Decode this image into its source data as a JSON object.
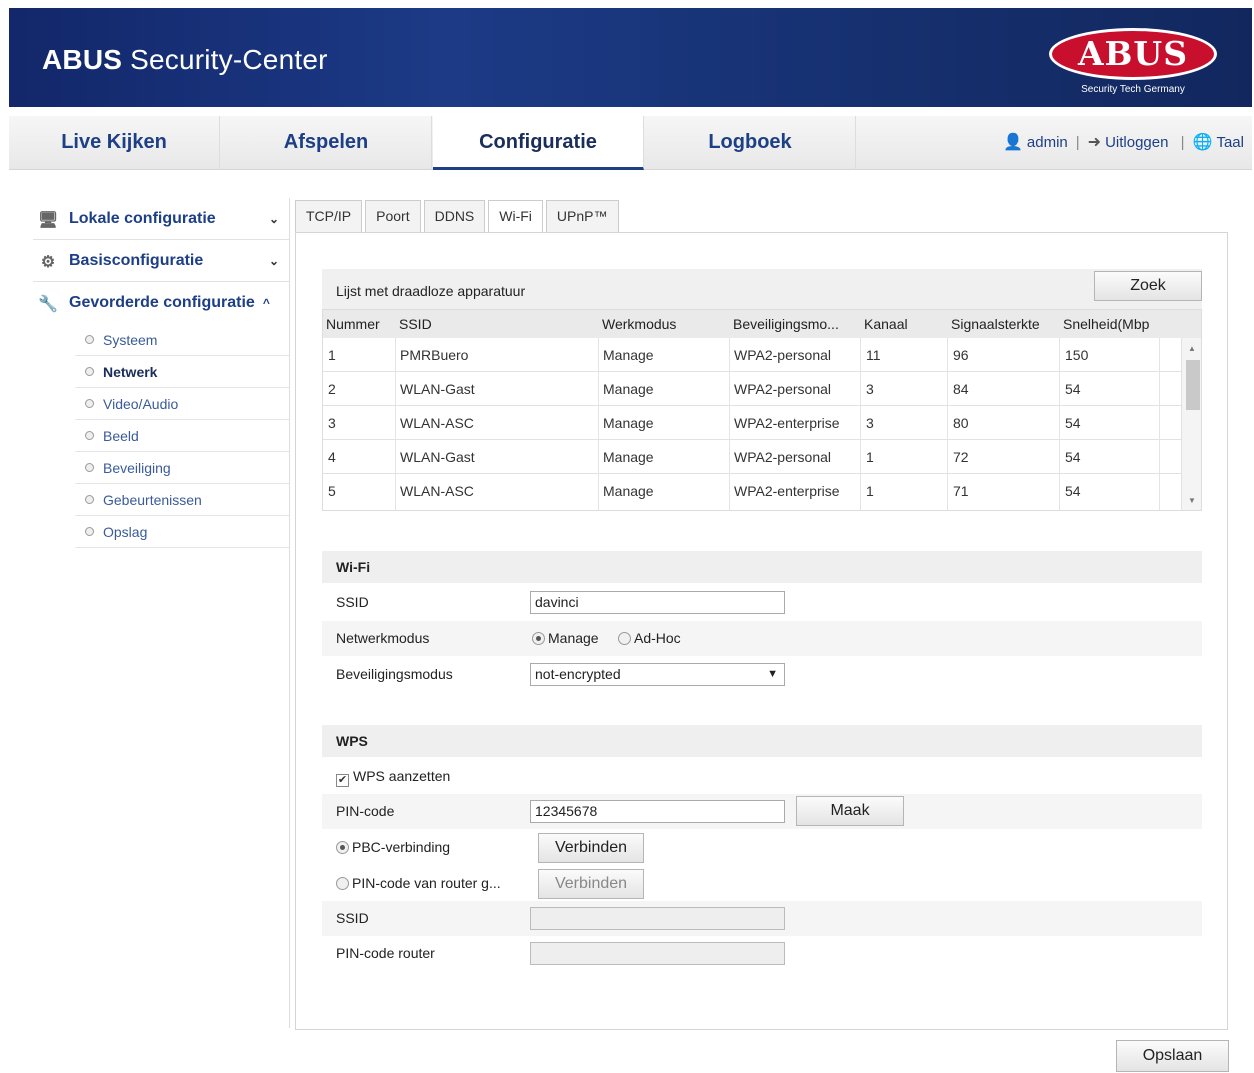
{
  "app": {
    "title_bold": "ABUS",
    "title_rest": " Security-Center",
    "logo_text": "ABUS",
    "logo_sub": "Security Tech Germany"
  },
  "nav": {
    "tabs": [
      "Live Kijken",
      "Afspelen",
      "Configuratie",
      "Logboek"
    ],
    "active": "Configuratie",
    "user": "admin",
    "logout": "Uitloggen",
    "language": "Taal"
  },
  "sidebar": {
    "groups": [
      {
        "label": "Lokale configuratie",
        "icon": "monitor-icon",
        "chevron": "⌄"
      },
      {
        "label": "Basisconfiguratie",
        "icon": "gear-icon",
        "chevron": "⌄"
      },
      {
        "label": "Gevorderde configuratie",
        "icon": "wrench-icon",
        "chevron": "^"
      }
    ],
    "items": [
      "Systeem",
      "Netwerk",
      "Video/Audio",
      "Beeld",
      "Beveiliging",
      "Gebeurtenissen",
      "Opslag"
    ],
    "active_item": "Netwerk"
  },
  "subtabs": [
    "TCP/IP",
    "Poort",
    "DDNS",
    "Wi-Fi",
    "UPnP™"
  ],
  "active_subtab": "Wi-Fi",
  "wireless_list": {
    "title": "Lijst met draadloze apparatuur",
    "search_button": "Zoek",
    "columns": [
      "Nummer",
      "SSID",
      "Werkmodus",
      "Beveiligingsmo...",
      "Kanaal",
      "Signaalsterkte",
      "Snelheid(Mbp"
    ],
    "rows": [
      [
        "1",
        "PMRBuero",
        "Manage",
        "WPA2-personal",
        "11",
        "96",
        "150"
      ],
      [
        "2",
        "WLAN-Gast",
        "Manage",
        "WPA2-personal",
        "3",
        "84",
        "54"
      ],
      [
        "3",
        "WLAN-ASC",
        "Manage",
        "WPA2-enterprise",
        "3",
        "80",
        "54"
      ],
      [
        "4",
        "WLAN-Gast",
        "Manage",
        "WPA2-personal",
        "1",
        "72",
        "54"
      ],
      [
        "5",
        "WLAN-ASC",
        "Manage",
        "WPA2-enterprise",
        "1",
        "71",
        "54"
      ]
    ]
  },
  "wifi": {
    "section_title": "Wi-Fi",
    "ssid_label": "SSID",
    "ssid_value": "davinci",
    "network_mode_label": "Netwerkmodus",
    "mode_manage": "Manage",
    "mode_adhoc": "Ad-Hoc",
    "security_label": "Beveiligingsmodus",
    "security_value": "not-encrypted"
  },
  "wps": {
    "section_title": "WPS",
    "enable_label": "WPS aanzetten",
    "pin_label": "PIN-code",
    "pin_value": "12345678",
    "make_button": "Maak",
    "pbc_label": "PBC-verbinding",
    "connect_button": "Verbinden",
    "router_pin_label": "PIN-code van router g...",
    "connect_button_2": "Verbinden",
    "ssid_label": "SSID",
    "router_code_label": "PIN-code router"
  },
  "save_button": "Opslaan"
}
